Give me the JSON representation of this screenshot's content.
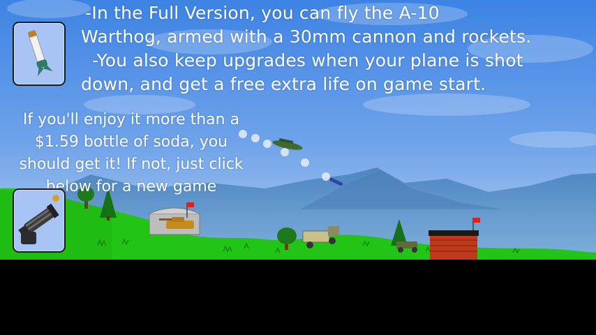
{
  "promo": {
    "line1": " -In the Full Version, you can fly the A-10",
    "line2": "Warthog, armed with a 30mm cannon and rockets.",
    "line3": "  -You also keep upgrades when your plane is shot",
    "line4": "down, and get a free extra life on game start."
  },
  "pitch": {
    "line1": "If you'll enjoy it more than a",
    "line2": "$1.59 bottle of soda, you",
    "line3": "should get it! If not, just click",
    "line4": "below for a new game"
  },
  "buttons": {
    "rocket_icon": "rocket-missile-icon",
    "gun_icon": "gatling-gun-icon"
  },
  "colors": {
    "sky_top": "#3f86e6",
    "sky_bottom": "#a9c9ee",
    "grass": "#21c414",
    "mountain": "#5a8fc6"
  }
}
